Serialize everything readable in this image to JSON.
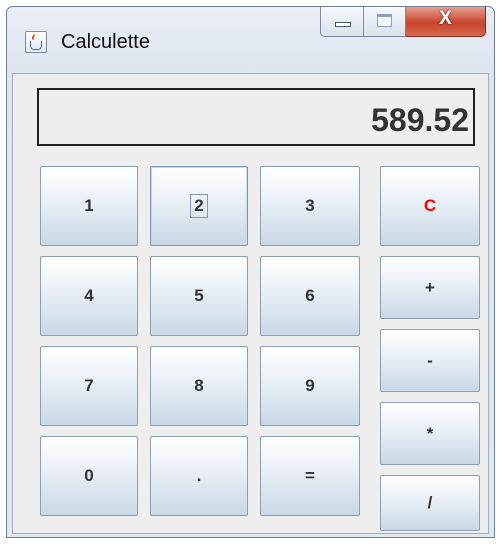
{
  "window": {
    "title": "Calculette",
    "icon": "java-cup-icon",
    "controls": {
      "minimize": "minimize-icon",
      "maximize": "maximize-icon",
      "close": "X"
    }
  },
  "display": {
    "value": "589.52"
  },
  "keypad": {
    "digits": [
      "1",
      "2",
      "3",
      "4",
      "5",
      "6",
      "7",
      "8",
      "9",
      "0",
      ".",
      "="
    ],
    "operators": [
      "C",
      "+",
      "-",
      "*",
      "/"
    ]
  },
  "colors": {
    "clear": "#ff0000",
    "text": "#333333"
  }
}
